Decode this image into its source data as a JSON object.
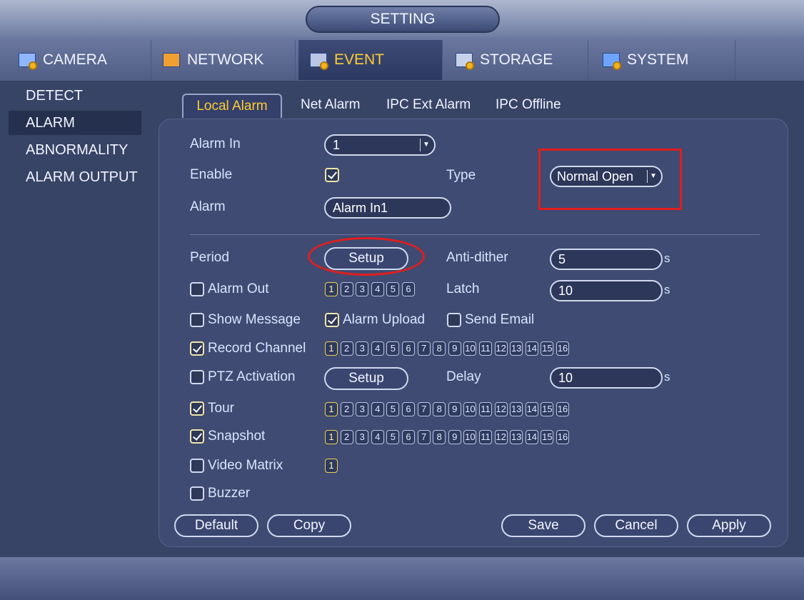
{
  "title": "SETTING",
  "top_tabs": [
    {
      "label": "CAMERA"
    },
    {
      "label": "NETWORK"
    },
    {
      "label": "EVENT"
    },
    {
      "label": "STORAGE"
    },
    {
      "label": "SYSTEM"
    }
  ],
  "sidebar": [
    "DETECT",
    "ALARM",
    "ABNORMALITY",
    "ALARM OUTPUT"
  ],
  "sub_tabs": [
    "Local Alarm",
    "Net Alarm",
    "IPC Ext Alarm",
    "IPC Offline"
  ],
  "form": {
    "alarm_in_label": "Alarm In",
    "alarm_in_value": "1",
    "enable_label": "Enable",
    "type_label": "Type",
    "type_value": "Normal Open",
    "alarm_label": "Alarm",
    "alarm_value": "Alarm In1",
    "period_label": "Period",
    "setup_label": "Setup",
    "anti_dither_label": "Anti-dither",
    "anti_dither_value": "5",
    "unit_s": "s",
    "alarm_out_label": "Alarm Out",
    "latch_label": "Latch",
    "latch_value": "10",
    "show_message_label": "Show Message",
    "alarm_upload_label": "Alarm Upload",
    "send_email_label": "Send Email",
    "record_channel_label": "Record Channel",
    "ptz_activation_label": "PTZ Activation",
    "ptz_setup_label": "Setup",
    "delay_label": "Delay",
    "delay_value": "10",
    "tour_label": "Tour",
    "snapshot_label": "Snapshot",
    "video_matrix_label": "Video Matrix",
    "buzzer_label": "Buzzer"
  },
  "alarm_out_channels": [
    "1",
    "2",
    "3",
    "4",
    "5",
    "6"
  ],
  "channels16": [
    "1",
    "2",
    "3",
    "4",
    "5",
    "6",
    "7",
    "8",
    "9",
    "10",
    "11",
    "12",
    "13",
    "14",
    "15",
    "16"
  ],
  "video_matrix_channels": [
    "1"
  ],
  "buttons": {
    "default": "Default",
    "copy": "Copy",
    "save": "Save",
    "cancel": "Cancel",
    "apply": "Apply"
  }
}
